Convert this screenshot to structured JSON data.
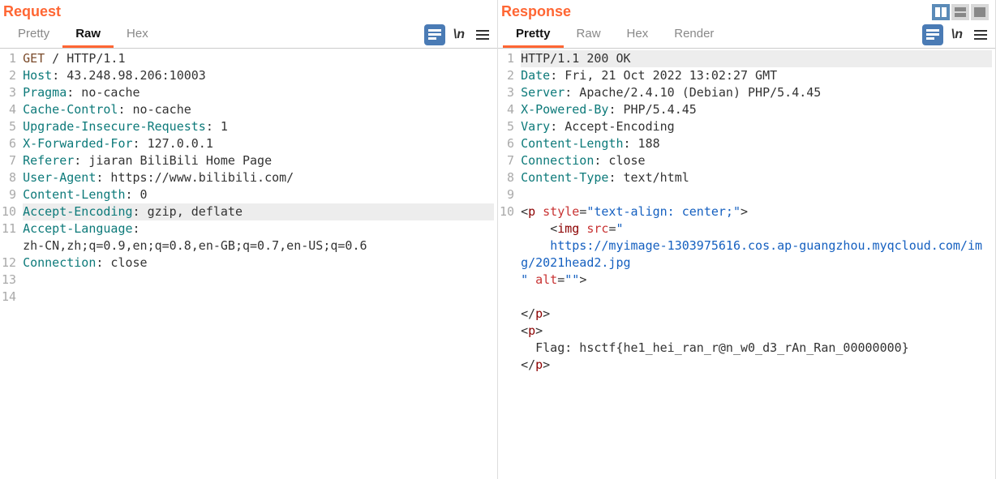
{
  "request": {
    "title": "Request",
    "tabs": [
      "Pretty",
      "Raw",
      "Hex"
    ],
    "activeTab": 1,
    "wrapLabel": "\\n",
    "lines": [
      {
        "n": "1",
        "type": "raw",
        "method": "GET",
        "rest": " / HTTP/1.1"
      },
      {
        "n": "2",
        "type": "hdr",
        "name": "Host",
        "val": " 43.248.98.206:10003"
      },
      {
        "n": "3",
        "type": "hdr",
        "name": "Pragma",
        "val": " no-cache"
      },
      {
        "n": "4",
        "type": "hdr",
        "name": "Cache-Control",
        "val": " no-cache"
      },
      {
        "n": "5",
        "type": "hdr",
        "name": "Upgrade-Insecure-Requests",
        "val": " 1"
      },
      {
        "n": "6",
        "type": "hdr",
        "name": "X-Forwarded-For",
        "val": " 127.0.0.1"
      },
      {
        "n": "7",
        "type": "hdr",
        "name": "Referer",
        "val": " jiaran BiliBili Home Page"
      },
      {
        "n": "8",
        "type": "hdr",
        "name": "User-Agent",
        "val": " https://www.bilibili.com/"
      },
      {
        "n": "9",
        "type": "hdr",
        "name": "Content-Length",
        "val": " 0"
      },
      {
        "n": "10",
        "type": "hdr",
        "name": "Accept-Encoding",
        "val": " gzip, deflate",
        "hl": true
      },
      {
        "n": "11",
        "type": "hdr",
        "name": "Accept-Language",
        "val": ""
      },
      {
        "n": "",
        "type": "cont",
        "text": "zh-CN,zh;q=0.9,en;q=0.8,en-GB;q=0.7,en-US;q=0.6"
      },
      {
        "n": "12",
        "type": "hdr",
        "name": "Connection",
        "val": " close"
      },
      {
        "n": "13",
        "type": "blank"
      },
      {
        "n": "14",
        "type": "blank"
      }
    ]
  },
  "response": {
    "title": "Response",
    "tabs": [
      "Pretty",
      "Raw",
      "Hex",
      "Render"
    ],
    "activeTab": 0,
    "wrapLabel": "\\n",
    "lines": [
      {
        "n": "1",
        "type": "status",
        "text": "HTTP/1.1 200 OK",
        "hl": true
      },
      {
        "n": "2",
        "type": "hdr",
        "name": "Date",
        "val": " Fri, 21 Oct 2022 13:02:27 GMT"
      },
      {
        "n": "3",
        "type": "hdr",
        "name": "Server",
        "val": " Apache/2.4.10 (Debian) PHP/5.4.45"
      },
      {
        "n": "4",
        "type": "hdr",
        "name": "X-Powered-By",
        "val": " PHP/5.4.45"
      },
      {
        "n": "5",
        "type": "hdr",
        "name": "Vary",
        "val": " Accept-Encoding"
      },
      {
        "n": "6",
        "type": "hdr",
        "name": "Content-Length",
        "val": " 188"
      },
      {
        "n": "7",
        "type": "hdr",
        "name": "Connection",
        "val": " close"
      },
      {
        "n": "8",
        "type": "hdr",
        "name": "Content-Type",
        "val": " text/html"
      },
      {
        "n": "9",
        "type": "blank"
      },
      {
        "n": "10",
        "type": "html_open",
        "lt": "<",
        "tag": "p",
        "sp": " ",
        "attr": "style",
        "eq": "=",
        "q1": "\"",
        "av": "text-align: center;",
        "q2": "\"",
        "gt": ">"
      },
      {
        "n": "",
        "type": "html_img_open",
        "pad": "    ",
        "lt": "<",
        "tag": "img",
        "sp": " ",
        "attr": "src",
        "eq": "=",
        "q": "\""
      },
      {
        "n": "",
        "type": "html_url",
        "pad": "    ",
        "url": "https://myimage-1303975616.cos.ap-guangzhou.myqcloud.com/img/2021head2.jpg"
      },
      {
        "n": "",
        "type": "html_img_close",
        "text": "\" alt=\"\">",
        "pad": ""
      },
      {
        "n": "",
        "type": "blank"
      },
      {
        "n": "",
        "type": "html_close",
        "lt": "</",
        "tag": "p",
        "gt": ">"
      },
      {
        "n": "",
        "type": "html_simple_open",
        "lt": "<",
        "tag": "p",
        "gt": ">"
      },
      {
        "n": "",
        "type": "flag",
        "pad": "  ",
        "text": "Flag: hsctf{he1_hei_ran_r@n_w0_d3_rAn_Ran_00000000}"
      },
      {
        "n": "",
        "type": "html_close",
        "lt": "</",
        "tag": "p",
        "gt": ">"
      }
    ]
  }
}
